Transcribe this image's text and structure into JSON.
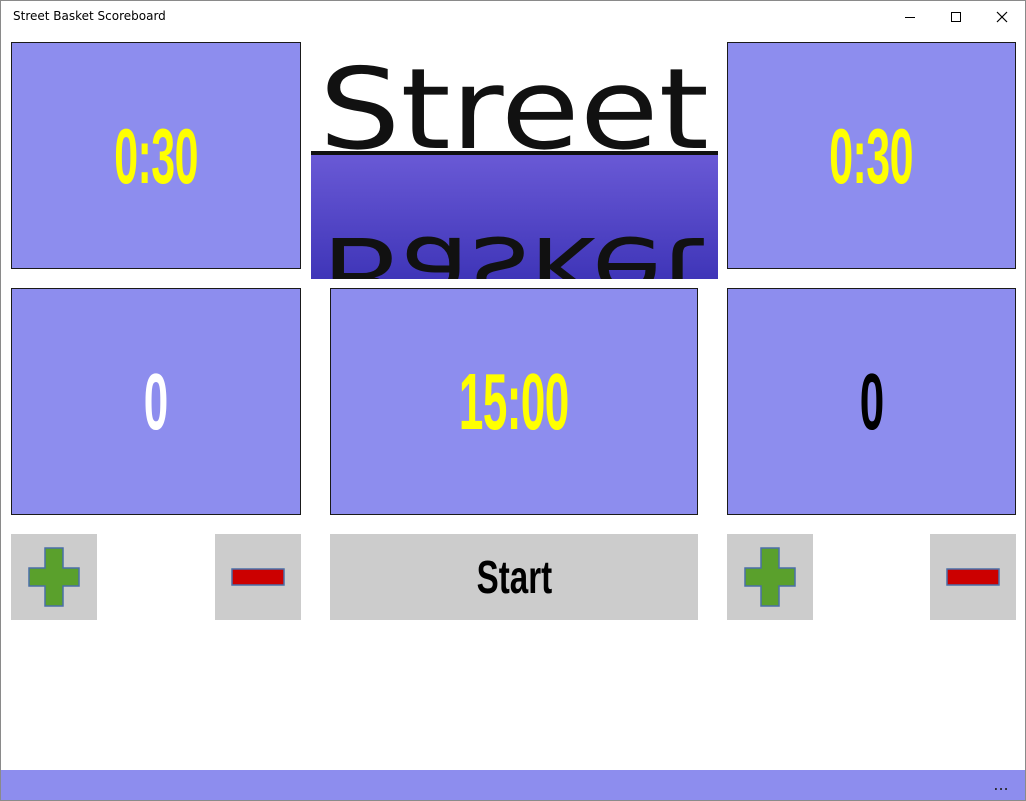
{
  "window": {
    "title": "Street Basket Scoreboard"
  },
  "logo": {
    "top_word": "Street",
    "bottom_word": "Basket"
  },
  "home": {
    "shot_clock": "0:30",
    "score": "0",
    "plus_icon": "plus-icon",
    "minus_icon": "minus-icon"
  },
  "away": {
    "shot_clock": "0:30",
    "score": "0",
    "plus_icon": "plus-icon",
    "minus_icon": "minus-icon"
  },
  "game_clock": "15:00",
  "start_button": {
    "label": "Start"
  },
  "bottom_bar": {
    "more_label": "..."
  },
  "colors": {
    "panel": "#8d8dee",
    "clock_text": "#ffff00",
    "home_score_text": "#ffffff",
    "away_score_text": "#000000",
    "button": "#cccccc",
    "plus": "#5aa02c",
    "minus": "#cc0000"
  }
}
